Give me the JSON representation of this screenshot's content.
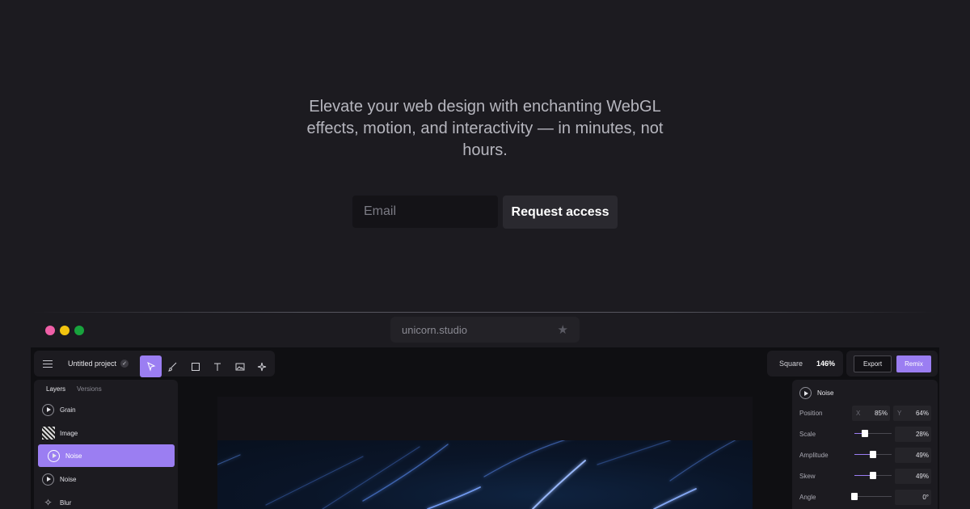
{
  "hero": {
    "lines": [
      "Elevate your web design with enchanting WebGL",
      "effects, motion, and interactivity — in minutes, not",
      "hours."
    ]
  },
  "signup": {
    "email_placeholder": "Email",
    "button_label": "Request access"
  },
  "browser": {
    "url": "unicorn.studio",
    "dots": [
      "#ef5fa7",
      "#f2c40f",
      "#18a33d"
    ]
  },
  "app": {
    "project_title": "Untitled project",
    "aspect_label": "Square",
    "zoom": "146%",
    "export_label": "Export",
    "remix_label": "Remix",
    "accent": "#9b7ef2",
    "tools": [
      "cursor-icon",
      "brush-icon",
      "rectangle-icon",
      "text-icon",
      "image-icon",
      "sparkle-icon"
    ],
    "layers_panel": {
      "tabs": [
        "Layers",
        "Versions"
      ],
      "items": [
        {
          "label": "Grain",
          "icon": "play-icon"
        },
        {
          "label": "Image",
          "icon": "image-thumb-icon"
        },
        {
          "label": "Noise",
          "icon": "play-icon",
          "selected": true
        },
        {
          "label": "Noise",
          "icon": "play-icon"
        },
        {
          "label": "Blur",
          "icon": "sparkle-icon"
        }
      ]
    },
    "properties": {
      "title": "Noise",
      "position": {
        "label": "Position",
        "x_axis": "X",
        "x": "85",
        "y_axis": "Y",
        "y": "64",
        "unit": "%"
      },
      "sliders": [
        {
          "label": "Scale",
          "value": "28",
          "unit": "%",
          "level": 0.28
        },
        {
          "label": "Amplitude",
          "value": "49",
          "unit": "%",
          "level": 0.49
        },
        {
          "label": "Skew",
          "value": "49",
          "unit": "%",
          "level": 0.49
        },
        {
          "label": "Angle",
          "value": "0",
          "unit": "°",
          "level": 0.0
        }
      ]
    }
  }
}
